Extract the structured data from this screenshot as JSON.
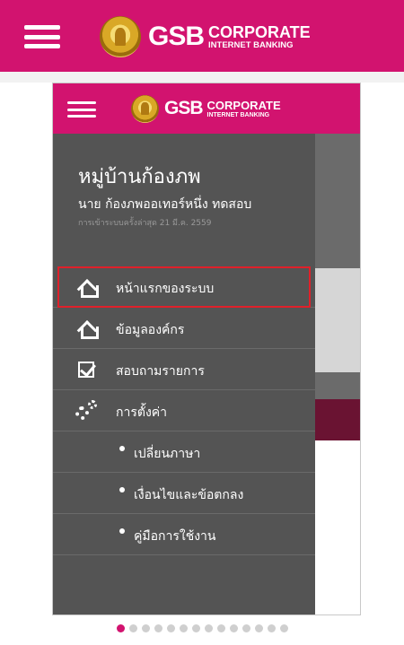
{
  "header": {
    "brand": "GSB",
    "brand_line1": "CORPORATE",
    "brand_line2": "INTERNET BANKING"
  },
  "drawer": {
    "org_name": "หมู่บ้านก้องภพ",
    "user_name": "นาย ก้องภพออเทอร์หนึ่ง ทดสอบ",
    "last_login": "การเข้าระบบครั้งล่าสุด 21 มี.ค. 2559",
    "items": [
      {
        "label": "หน้าแรกของระบบ",
        "icon": "home-icon"
      },
      {
        "label": "ข้อมูลองค์กร",
        "icon": "home-icon"
      },
      {
        "label": "สอบถามรายการ",
        "icon": "checkbox-icon"
      },
      {
        "label": "การตั้งค่า",
        "icon": "gears-icon"
      },
      {
        "label": "เปลี่ยนภาษา"
      },
      {
        "label": "เงื่อนไขและข้อตกลง"
      },
      {
        "label": "คู่มือการใช้งาน"
      }
    ],
    "selected_index": 0
  },
  "colors": {
    "brand_magenta": "#d2136f",
    "drawer_bg": "#545454",
    "highlight_border": "#e0202a"
  },
  "pager": {
    "total": 14,
    "active": 1
  }
}
